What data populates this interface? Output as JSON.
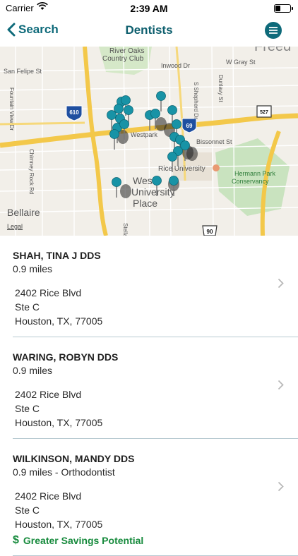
{
  "status_bar": {
    "carrier": "Carrier",
    "time": "2:39 AM"
  },
  "nav": {
    "back_label": "Search",
    "title": "Dentists"
  },
  "map": {
    "labels": {
      "river_oaks": "River Oaks",
      "country_club": "Country Club",
      "inwood": "Inwood Dr",
      "gray": "W Gray St",
      "san_felipe": "San Felipe St",
      "fountain": "Fountain View Dr",
      "chimney": "Chimney Rock Rd",
      "westpark": "Westpark",
      "bissonnet": "Bissonnet St",
      "rice": "Rice University",
      "hermann": "Hermann Park",
      "conservancy": "Conservancy",
      "west": "West",
      "university": "University",
      "place": "Place",
      "bellaire": "Bellaire",
      "stella": "Stella Lin",
      "shepherd": "S Shepherd Dr",
      "dunlavy": "Dunlavy St",
      "freedmen": "Freed",
      "i610": "610",
      "i69": "69",
      "s527": "527",
      "us90": "90"
    },
    "legal": "Legal"
  },
  "results": [
    {
      "name": "SHAH, TINA J DDS",
      "distance": "0.9 miles",
      "address_line1": "2402 Rice Blvd",
      "address_line2": "Ste C",
      "city_state_zip": "Houston, TX, 77005"
    },
    {
      "name": "WARING, ROBYN DDS",
      "distance": "0.9 miles",
      "address_line1": "2402 Rice Blvd",
      "address_line2": "Ste C",
      "city_state_zip": "Houston, TX, 77005"
    },
    {
      "name": "WILKINSON, MANDY DDS",
      "distance": "0.9 miles - Orthodontist",
      "address_line1": "2402 Rice Blvd",
      "address_line2": "Ste C",
      "city_state_zip": "Houston, TX, 77005",
      "badge": "Greater Savings Potential"
    }
  ],
  "colors": {
    "accent": "#0e6a7a",
    "pin": "#1893a6",
    "savings_green": "#168a3c",
    "highway": "#f7c948"
  }
}
